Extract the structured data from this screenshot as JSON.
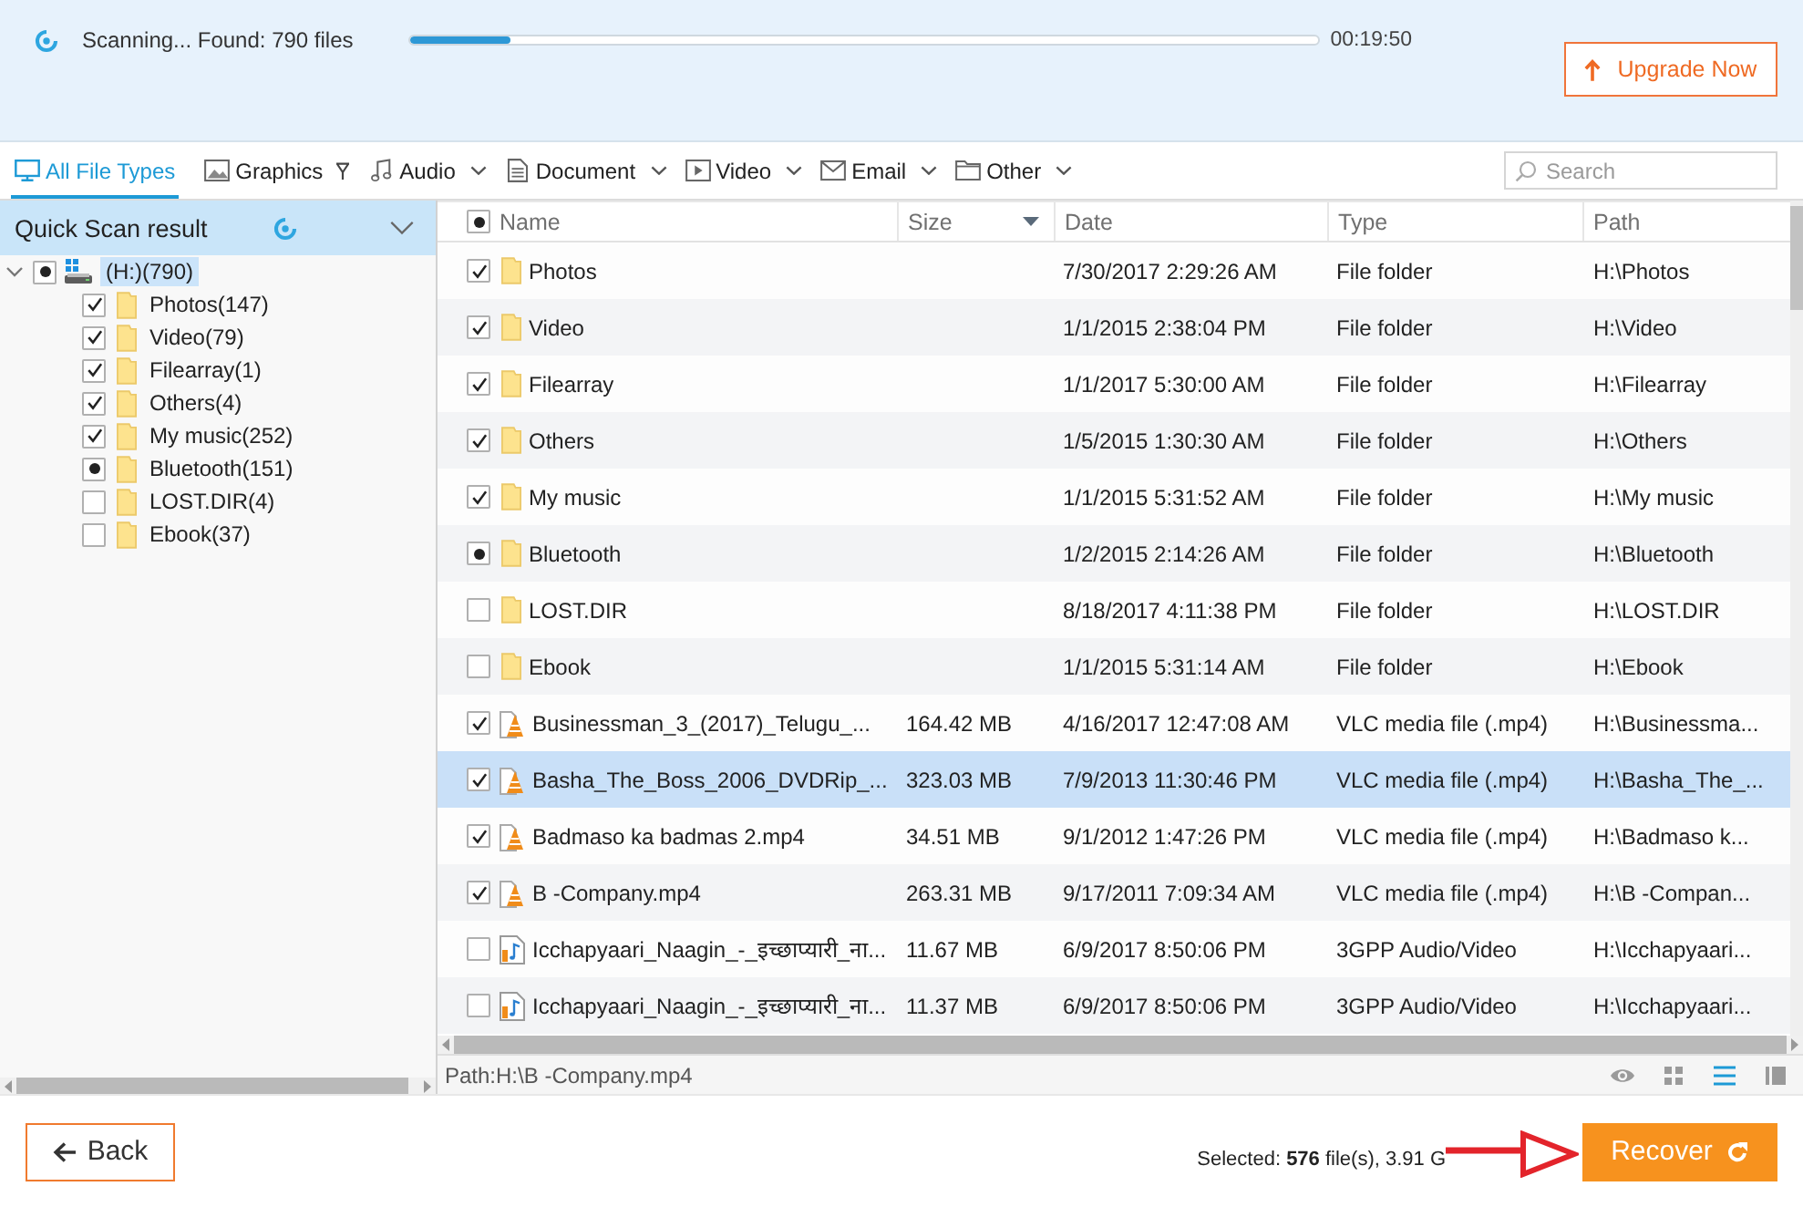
{
  "scan": {
    "status": "Scanning... Found: 790 files",
    "progress": {
      "level": 0.11
    },
    "elapsed": "00:19:50"
  },
  "upgrade_button": {
    "label": "Upgrade Now"
  },
  "file_type_tabs": [
    {
      "label": "All File Types",
      "selected": true,
      "filter": false,
      "dropdown": false
    },
    {
      "label": "Graphics",
      "selected": false,
      "filter": true,
      "dropdown": false
    },
    {
      "label": "Audio",
      "selected": false,
      "filter": false,
      "dropdown": true
    },
    {
      "label": "Document",
      "selected": false,
      "filter": false,
      "dropdown": true
    },
    {
      "label": "Video",
      "selected": false,
      "filter": false,
      "dropdown": true
    },
    {
      "label": "Email",
      "selected": false,
      "filter": false,
      "dropdown": true
    },
    {
      "label": "Other",
      "selected": false,
      "filter": false,
      "dropdown": true
    }
  ],
  "search": {
    "placeholder": "Search"
  },
  "sidebar": {
    "title": "Quick Scan result",
    "tree": [
      {
        "kind": "drive",
        "label": "(H:)(790)",
        "checked": true,
        "partial": true,
        "expanded": true,
        "selected": true,
        "children": [
          {
            "kind": "folder",
            "label": "Photos(147)",
            "checked": true,
            "partial": false,
            "selected": false
          },
          {
            "kind": "folder",
            "label": "Video(79)",
            "checked": true,
            "partial": false,
            "selected": false
          },
          {
            "kind": "folder",
            "label": "Filearray(1)",
            "checked": true,
            "partial": false,
            "selected": false
          },
          {
            "kind": "folder",
            "label": "Others(4)",
            "checked": true,
            "partial": false,
            "selected": false
          },
          {
            "kind": "folder",
            "label": "My music(252)",
            "checked": true,
            "partial": false,
            "selected": false
          },
          {
            "kind": "folder",
            "label": "Bluetooth(151)",
            "checked": true,
            "partial": true,
            "selected": false
          },
          {
            "kind": "folder",
            "label": "LOST.DIR(4)",
            "checked": false,
            "partial": false,
            "selected": false
          },
          {
            "kind": "folder",
            "label": "Ebook(37)",
            "checked": false,
            "partial": false,
            "selected": false
          }
        ]
      }
    ]
  },
  "table": {
    "header_checkbox": {
      "checked": true,
      "partial": true
    },
    "columns": [
      {
        "label": "Name",
        "sorted": false
      },
      {
        "label": "Size",
        "sorted": true
      },
      {
        "label": "Date",
        "sorted": false
      },
      {
        "label": "Type",
        "sorted": false
      },
      {
        "label": "Path",
        "sorted": false
      }
    ],
    "rows": [
      {
        "kind": "folder",
        "checked": true,
        "partial": false,
        "selected": false,
        "name": "Photos",
        "date": "7/30/2017 2:29:26 AM",
        "type": "File folder",
        "path": "H:\\Photos"
      },
      {
        "kind": "folder",
        "checked": true,
        "partial": false,
        "selected": false,
        "name": "Video",
        "date": "1/1/2015 2:38:04 PM",
        "type": "File folder",
        "path": "H:\\Video"
      },
      {
        "kind": "folder",
        "checked": true,
        "partial": false,
        "selected": false,
        "name": "Filearray",
        "date": "1/1/2017 5:30:00 AM",
        "type": "File folder",
        "path": "H:\\Filearray"
      },
      {
        "kind": "folder",
        "checked": true,
        "partial": false,
        "selected": false,
        "name": "Others",
        "date": "1/5/2015 1:30:30 AM",
        "type": "File folder",
        "path": "H:\\Others"
      },
      {
        "kind": "folder",
        "checked": true,
        "partial": false,
        "selected": false,
        "name": "My music",
        "date": "1/1/2015 5:31:52 AM",
        "type": "File folder",
        "path": "H:\\My music"
      },
      {
        "kind": "folder",
        "checked": true,
        "partial": true,
        "selected": false,
        "name": "Bluetooth",
        "date": "1/2/2015 2:14:26 AM",
        "type": "File folder",
        "path": "H:\\Bluetooth"
      },
      {
        "kind": "folder",
        "checked": false,
        "partial": false,
        "selected": false,
        "name": "LOST.DIR",
        "date": "8/18/2017 4:11:38 PM",
        "type": "File folder",
        "path": "H:\\LOST.DIR"
      },
      {
        "kind": "folder",
        "checked": false,
        "partial": false,
        "selected": false,
        "name": "Ebook",
        "date": "1/1/2015 5:31:14 AM",
        "type": "File folder",
        "path": "H:\\Ebook"
      },
      {
        "kind": "vlc",
        "checked": true,
        "partial": false,
        "selected": false,
        "name": "Businessman_3_(2017)_Telugu_...",
        "size": "164.42 MB",
        "date": "4/16/2017 12:47:08 AM",
        "type": "VLC media file (.mp4)",
        "path": "H:\\Businessma..."
      },
      {
        "kind": "vlc",
        "checked": true,
        "partial": false,
        "selected": true,
        "name": "Basha_The_Boss_2006_DVDRip_...",
        "size": "323.03 MB",
        "date": "7/9/2013 11:30:46 PM",
        "type": "VLC media file (.mp4)",
        "path": "H:\\Basha_The_..."
      },
      {
        "kind": "vlc",
        "checked": true,
        "partial": false,
        "selected": false,
        "name": "Badmaso ka badmas 2.mp4",
        "size": "34.51 MB",
        "date": "9/1/2012 1:47:26 PM",
        "type": "VLC media file (.mp4)",
        "path": "H:\\Badmaso k..."
      },
      {
        "kind": "vlc",
        "checked": true,
        "partial": false,
        "selected": false,
        "name": "B -Company.mp4",
        "size": "263.31 MB",
        "date": "9/17/2011 7:09:34 AM",
        "type": "VLC media file (.mp4)",
        "path": "H:\\B -Compan..."
      },
      {
        "kind": "media",
        "checked": false,
        "partial": false,
        "selected": false,
        "name": "Icchapyaari_Naagin_-_इच्छाप्यारी_ना...",
        "size": "11.67 MB",
        "date": "6/9/2017 8:50:06 PM",
        "type": "3GPP Audio/Video",
        "path": "H:\\Icchapyaari..."
      },
      {
        "kind": "media",
        "checked": false,
        "partial": false,
        "selected": false,
        "name": "Icchapyaari_Naagin_-_इच्छाप्यारी_ना...",
        "size": "11.37 MB",
        "date": "6/9/2017 8:50:06 PM",
        "type": "3GPP Audio/Video",
        "path": "H:\\Icchapyaari..."
      }
    ]
  },
  "path_bar": {
    "text": "Path:H:\\B -Company.mp4",
    "view_buttons": [
      {
        "selected": false
      },
      {
        "selected": false
      },
      {
        "selected": true
      },
      {
        "selected": false
      }
    ]
  },
  "footer": {
    "back_button": "Back",
    "selection_summary": "Selected: **576** file(s), 3.91 G",
    "recover_button": "Recover"
  }
}
